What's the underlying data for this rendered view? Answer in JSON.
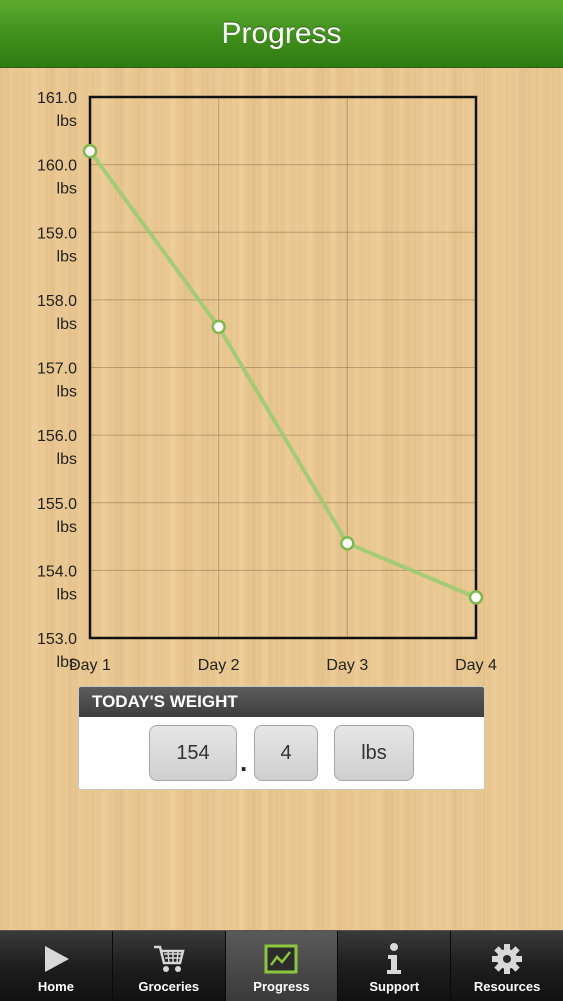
{
  "header": {
    "title": "Progress"
  },
  "chart_data": {
    "type": "line",
    "categories": [
      "Day 1",
      "Day 2",
      "Day 3",
      "Day 4"
    ],
    "values": [
      160.2,
      157.6,
      154.4,
      153.6
    ],
    "ylim": [
      153.0,
      161.0
    ],
    "yticks": [
      161.0,
      160.0,
      159.0,
      158.0,
      157.0,
      156.0,
      155.0,
      154.0,
      153.0
    ],
    "ytick_labels": [
      "161.0",
      "160.0",
      "159.0",
      "158.0",
      "157.0",
      "156.0",
      "155.0",
      "154.0",
      "153.0"
    ],
    "unit_label": "lbs",
    "grid": true,
    "line_color": "#9ccb72"
  },
  "todays_weight": {
    "title": "TODAY'S WEIGHT",
    "whole": "154",
    "separator": ".",
    "decimal": "4",
    "unit": "lbs"
  },
  "tabs": [
    {
      "label": "Home",
      "icon": "play-icon",
      "active": false
    },
    {
      "label": "Groceries",
      "icon": "cart-icon",
      "active": false
    },
    {
      "label": "Progress",
      "icon": "chart-icon",
      "active": true
    },
    {
      "label": "Support",
      "icon": "info-icon",
      "active": false
    },
    {
      "label": "Resources",
      "icon": "gear-icon",
      "active": false
    }
  ]
}
